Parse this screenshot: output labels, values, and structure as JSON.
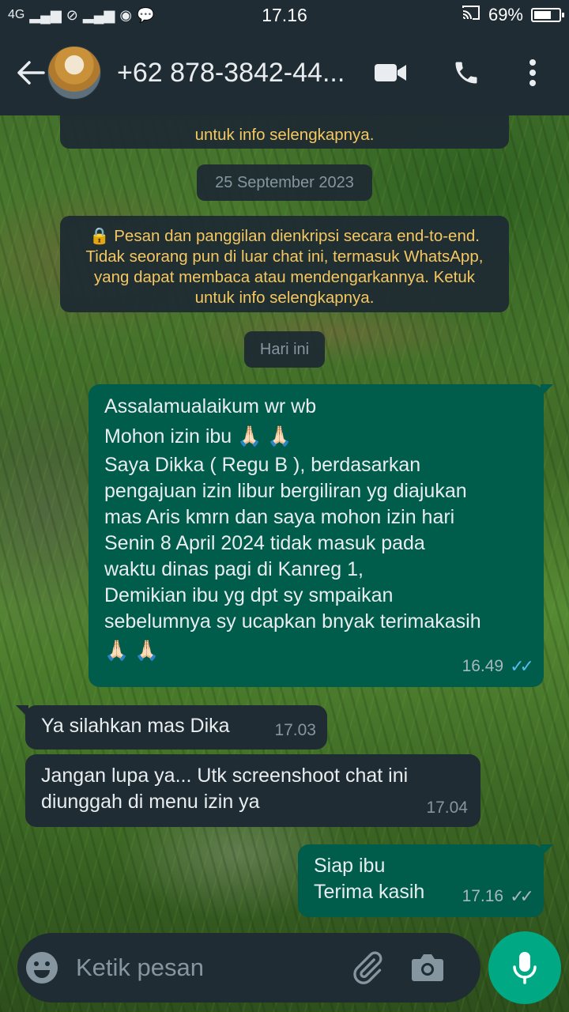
{
  "status_bar": {
    "network": "4G",
    "time": "17.16",
    "battery": "69%",
    "battery_level": 0.69
  },
  "header": {
    "contact": "+62 878-3842-44...",
    "icons": [
      "back-arrow-icon",
      "video-call-icon",
      "phone-icon",
      "more-vert-icon"
    ]
  },
  "chat": {
    "old_encryption_notice_tail": "untuk info selengkapnya.",
    "date_1": "25 September 2023",
    "encryption_notice": [
      "🔒 Pesan dan panggilan dienkripsi secara end-to-end.",
      "Tidak seorang pun di luar chat ini, termasuk WhatsApp,",
      "yang dapat membaca atau mendengarkannya. Ketuk",
      "untuk info selengkapnya."
    ],
    "date_2": "Hari ini",
    "messages": [
      {
        "direction": "out",
        "lines": [
          "Assalamualaikum wr wb",
          "Mohon izin ibu 🙏🏻 🙏🏻",
          "Saya Dikka ( Regu B ), berdasarkan",
          "pengajuan izin libur bergiliran yg diajukan",
          "mas Aris kmrn dan saya  mohon izin hari",
          "Senin 8 April 2024 tidak masuk pada",
          "waktu dinas pagi di Kanreg 1,",
          "Demikian ibu yg dpt sy smpaikan",
          "sebelumnya sy ucapkan bnyak terimakasih",
          "🙏🏻 🙏🏻"
        ],
        "time": "16.49",
        "status": "read"
      },
      {
        "direction": "in",
        "lines": [
          "Ya silahkan mas Dika"
        ],
        "time": "17.03"
      },
      {
        "direction": "in",
        "lines": [
          "Jangan lupa ya... Utk screenshoot chat ini",
          "diunggah di menu izin ya"
        ],
        "time": "17.04"
      },
      {
        "direction": "out",
        "lines": [
          "Siap ibu",
          "Terima kasih"
        ],
        "time": "17.16",
        "status": "delivered"
      }
    ]
  },
  "input": {
    "placeholder": "Ketik pesan",
    "icons": [
      "emoji-icon",
      "attachment-icon",
      "camera-icon",
      "microphone-icon"
    ]
  },
  "colors": {
    "header_bg": "#1f2c33",
    "outgoing_bubble": "#005c4b",
    "incoming_bubble": "#1f2c33",
    "notice_text": "#f5c761",
    "read_ticks": "#53bdeb",
    "mic_button": "#00a884"
  }
}
